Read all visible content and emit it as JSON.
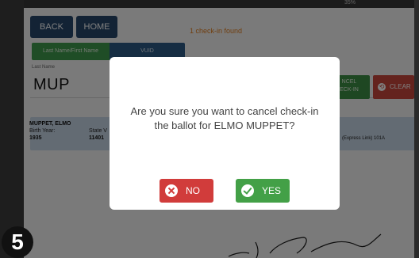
{
  "status_bar": {
    "text": "35%"
  },
  "nav": {
    "back_label": "BACK",
    "home_label": "HOME"
  },
  "search": {
    "found_text": "1 check-in found",
    "tab_lastname": "Last Name/First Name",
    "tab_vuid": "VUID",
    "field_label": "Last Name",
    "value": "MUP"
  },
  "actions": {
    "cancel_label_1": "NCEL",
    "cancel_label_2": "ECK-IN",
    "clear_label": "CLEAR"
  },
  "result": {
    "name": "MUPPET, ELMO",
    "birth_year_label": "Birth Year:",
    "birth_year": "1935",
    "state_label": "State V",
    "state_value": "11401",
    "precinct": "(Express Link) 101A"
  },
  "modal": {
    "line1": "Are you sure you want to cancel check-in",
    "line2": "the ballot for ELMO MUPPET?",
    "no_label": "NO",
    "yes_label": "YES"
  },
  "step": {
    "number": "5"
  },
  "colors": {
    "nav": "#26466b",
    "no": "#d13c3b",
    "yes": "#43a047",
    "found": "#e07d1e"
  }
}
